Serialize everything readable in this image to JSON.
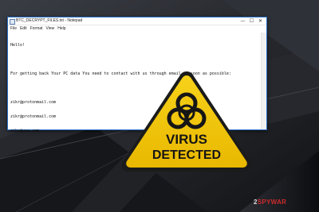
{
  "window": {
    "title": "BTC_DECRYPT_FILES.txt - Notepad",
    "controls": [
      "—",
      "☐",
      "✕"
    ]
  },
  "menu": [
    "File",
    "Edit",
    "Format",
    "View",
    "Help"
  ],
  "document": {
    "lines": [
      "Hello!",
      "",
      "For getting back Your PC data You need to contact with us through email as soon as possible:",
      "",
      "zikr@protonmail.com",
      "zikr@protonmail.com",
      "zikr@usa.com"
    ]
  },
  "badge": {
    "line1": "VIRUS",
    "line2": "DETECTED"
  },
  "watermark": {
    "part1": "2",
    "part2": "SPYWAR"
  },
  "colors": {
    "warning_yellow": "#f3c400",
    "window_border": "#2a6fc9",
    "background": "#1a1c20"
  }
}
